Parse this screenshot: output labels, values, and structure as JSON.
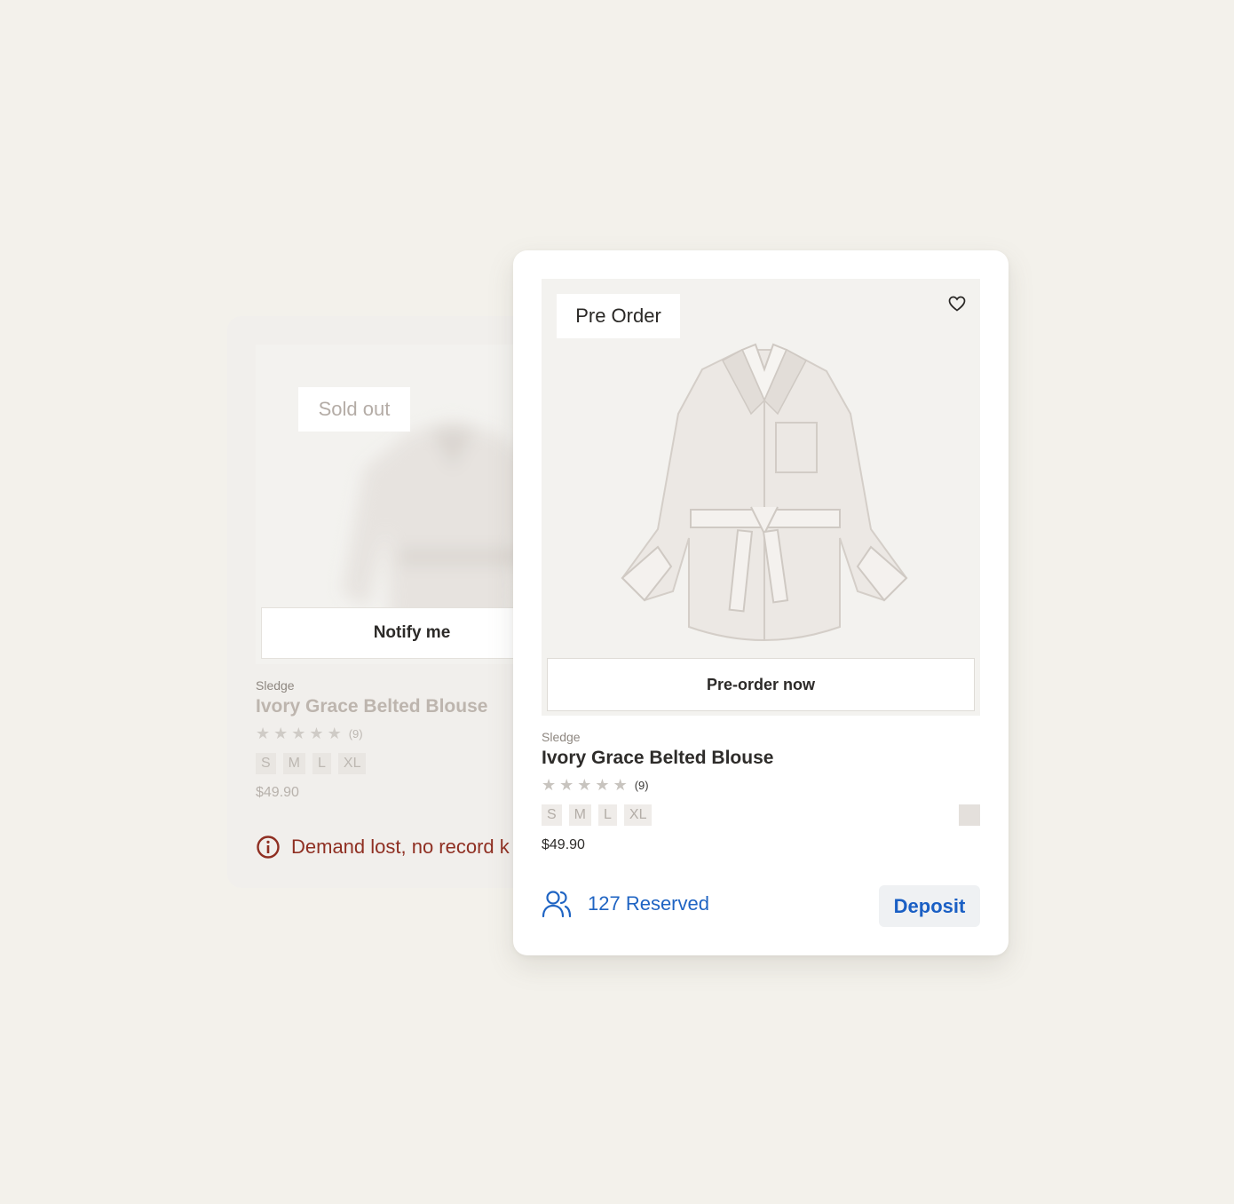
{
  "sold_out_card": {
    "badge": "Sold out",
    "notify_label": "Notify me",
    "brand": "Sledge",
    "title": "Ivory Grace Belted Blouse",
    "rating_count": "(9)",
    "rating_value": 0,
    "sizes": [
      "S",
      "M",
      "L",
      "XL"
    ],
    "price": "$49.90",
    "warning": "Demand lost, no record k"
  },
  "preorder_card": {
    "badge": "Pre Order",
    "preorder_label": "Pre-order now",
    "brand": "Sledge",
    "title": "Ivory Grace Belted Blouse",
    "rating_count": "(9)",
    "rating_value": 0,
    "sizes": [
      "S",
      "M",
      "L",
      "XL"
    ],
    "price": "$49.90",
    "reserved": "127 Reserved",
    "deposit_label": "Deposit",
    "swatch_color": "#e4e0dc"
  },
  "colors": {
    "accent_blue": "#1f64c3",
    "warning_red": "#8f2f22",
    "background": "#f3f1eb"
  },
  "icons": {
    "wishlist": "heart-icon",
    "reserved": "users-icon",
    "warning": "info-icon",
    "rating": "star-icon"
  }
}
